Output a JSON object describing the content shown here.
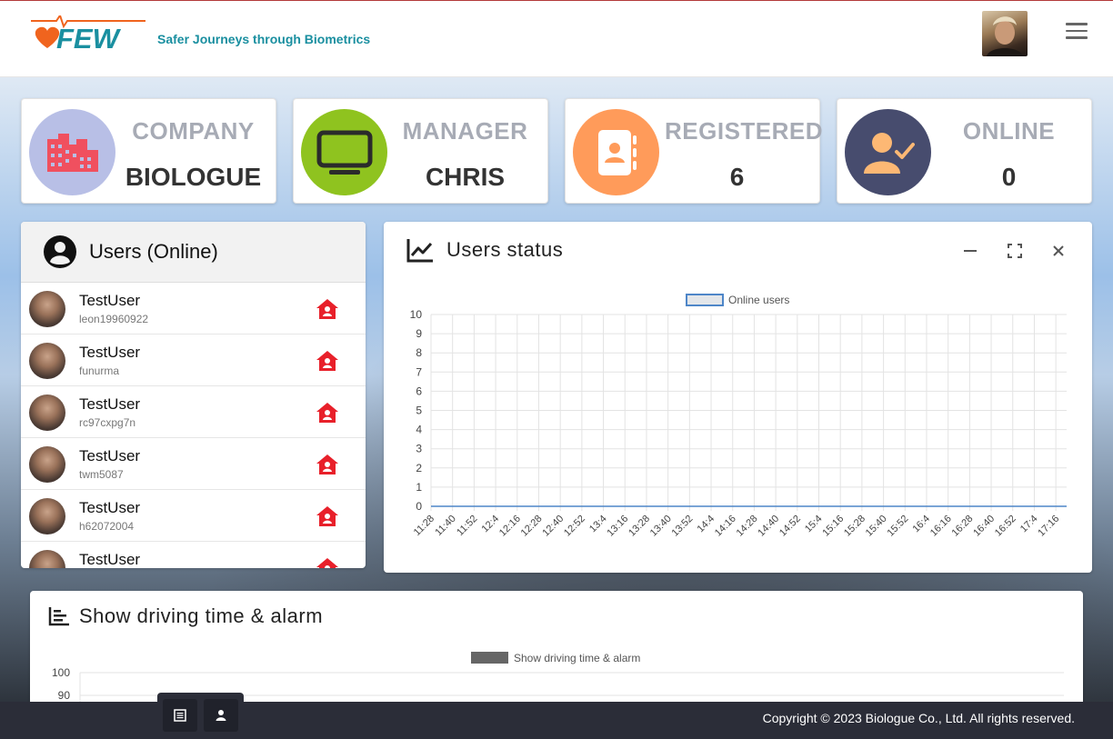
{
  "header": {
    "logo_text": "FEW",
    "tagline": "Safer Journeys through Biometrics"
  },
  "stats": [
    {
      "label": "COMPANY",
      "value": "BIOLOGUE",
      "icon": "building-icon",
      "color": "#b8bfe6"
    },
    {
      "label": "MANAGER",
      "value": "CHRIS",
      "icon": "monitor-icon",
      "color": "#8fc31f"
    },
    {
      "label": "REGISTERED",
      "value": "6",
      "icon": "contact-book-icon",
      "color": "#ff9b5a"
    },
    {
      "label": "ONLINE",
      "value": "0",
      "icon": "user-check-icon",
      "color": "#474c6e"
    }
  ],
  "users_panel": {
    "title": "Users (Online)",
    "users": [
      {
        "name": "TestUser",
        "id": "leon19960922"
      },
      {
        "name": "TestUser",
        "id": "funurma"
      },
      {
        "name": "TestUser",
        "id": "rc97cxpg7n"
      },
      {
        "name": "TestUser",
        "id": "twm5087"
      },
      {
        "name": "TestUser",
        "id": "h62072004"
      },
      {
        "name": "TestUser",
        "id": ""
      }
    ]
  },
  "status_panel": {
    "title": "Users status"
  },
  "driving_panel": {
    "title": "Show driving time & alarm"
  },
  "chart_data": [
    {
      "type": "line",
      "legend": [
        "Online users"
      ],
      "legend_position": "top-center",
      "grid": true,
      "x": [
        "11:28",
        "11:40",
        "11:52",
        "12:4",
        "12:16",
        "12:28",
        "12:40",
        "12:52",
        "13:4",
        "13:16",
        "13:28",
        "13:40",
        "13:52",
        "14:4",
        "14:16",
        "14:28",
        "14:40",
        "14:52",
        "15:4",
        "15:16",
        "15:28",
        "15:40",
        "15:52",
        "16:4",
        "16:16",
        "16:28",
        "16:40",
        "16:52",
        "17:4",
        "17:16"
      ],
      "series": [
        {
          "name": "Online users",
          "values": [
            0,
            0,
            0,
            0,
            0,
            0,
            0,
            0,
            0,
            0,
            0,
            0,
            0,
            0,
            0,
            0,
            0,
            0,
            0,
            0,
            0,
            0,
            0,
            0,
            0,
            0,
            0,
            0,
            0,
            0
          ]
        }
      ],
      "ylim": [
        0,
        10
      ],
      "yticks": [
        0,
        1,
        2,
        3,
        4,
        5,
        6,
        7,
        8,
        9,
        10
      ],
      "color": "#4e86c8"
    },
    {
      "type": "bar",
      "legend": [
        "Show driving time & alarm"
      ],
      "legend_position": "top-center",
      "grid": true,
      "yticks_visible": [
        100,
        90
      ],
      "series": [
        {
          "name": "Show driving time & alarm",
          "values": []
        }
      ],
      "color": "#666666"
    }
  ],
  "footer": {
    "copyright": "Copyright © 2023 Biologue Co., Ltd. All rights reserved."
  }
}
